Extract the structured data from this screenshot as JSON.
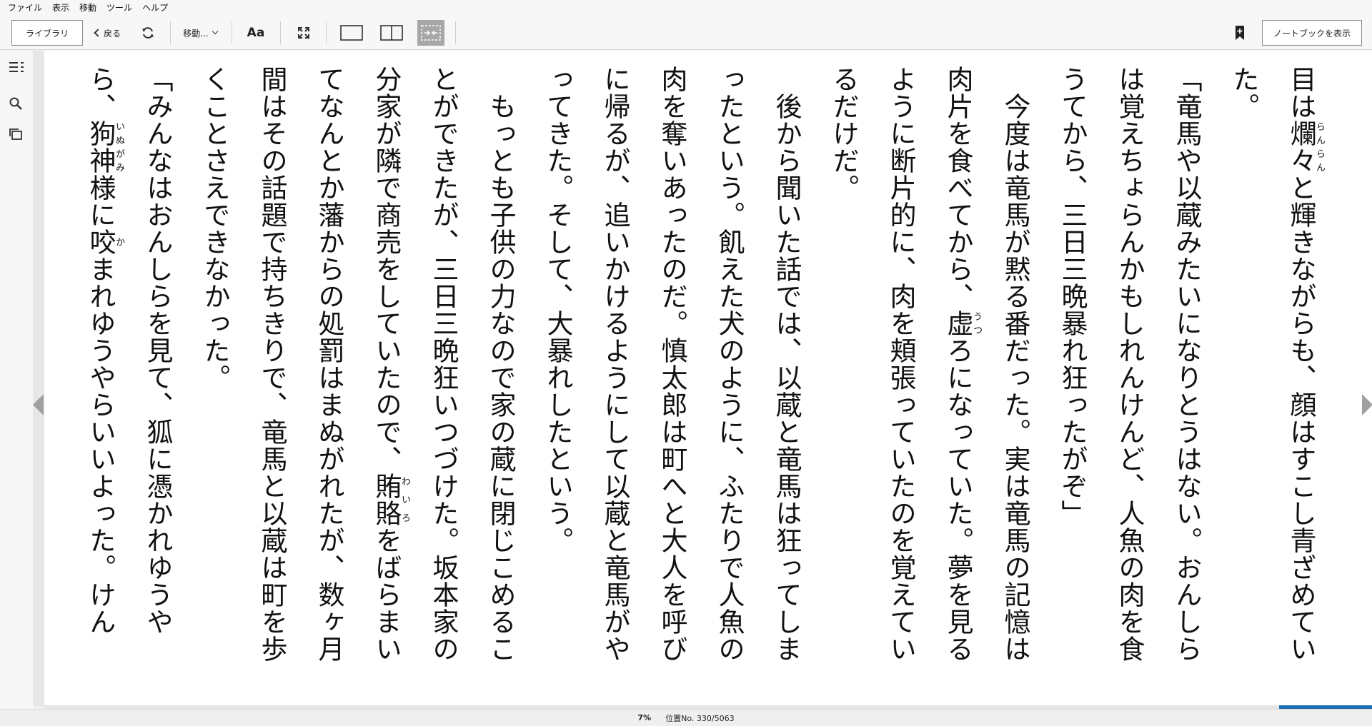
{
  "menubar": {
    "items": [
      "ファイル",
      "表示",
      "移動",
      "ツール",
      "ヘルプ"
    ]
  },
  "toolbar": {
    "library_label": "ライブラリ",
    "back_label": "戻る",
    "goto_label": "移動...",
    "font_label": "Aa",
    "notebook_label": "ノートブックを表示"
  },
  "colors": {
    "accent": "#1f6fb5",
    "toolbar_bg": "#f7f7f7",
    "page_bg": "#ffffff",
    "active_button_bg": "#a7a7a7"
  },
  "icons": {
    "sync": "sync-icon",
    "fullscreen": "fullscreen-icon",
    "single_page": "single-page-icon",
    "two_page": "two-page-icon",
    "fit_width": "fit-width-icon",
    "bookmark": "bookmark-icon",
    "toc": "toc-icon",
    "search": "search-icon",
    "flashcards": "flashcards-icon"
  },
  "book": {
    "paragraphs": [
      {
        "segments": [
          {
            "t": "目は"
          },
          {
            "t": "爛々",
            "ruby": "らんらん"
          },
          {
            "t": "と輝きながらも、顔はすこし青ざめていた。"
          }
        ]
      },
      {
        "segments": [
          {
            "t": "「竜馬や以蔵みたいになりとうはない。おんしらは覚えちょらんかもしれんけんど、人魚の肉を食うてから、三日三晩暴れ狂ったがぞ」"
          }
        ]
      },
      {
        "segments": [
          {
            "t": "　今度は竜馬が黙る番だった。実は竜馬の記憶は肉片を食べてから、"
          },
          {
            "t": "虚",
            "ruby": "うつ"
          },
          {
            "t": "ろになっていた。夢を見るように断片的に、肉を頬張っていたのを覚えているだけだ。"
          }
        ]
      },
      {
        "segments": [
          {
            "t": "　後から聞いた話では、以蔵と竜馬は狂ってしまったという。飢えた犬のように、ふたりで人魚の肉を奪いあったのだ。慎太郎は町へと大人を呼びに帰るが、追いかけるようにして以蔵と竜馬がやってきた。そして、大暴れしたという。"
          }
        ]
      },
      {
        "segments": [
          {
            "t": "　もっとも子供の力なので家の蔵に閉じこめることができたが、三日三晩狂いつづけた。坂本家の分家が隣で商売をしていたので、"
          },
          {
            "t": "賄賂",
            "ruby": "わいろ"
          },
          {
            "t": "をばらまいてなんとか藩からの処罰はまぬがれたが、数ヶ月間はその話題で持ちきりで、竜馬と以蔵は町を歩くことさえできなかった。"
          }
        ]
      },
      {
        "segments": [
          {
            "t": "「みんなはおんしらを見て、狐に憑かれゆうやら、"
          },
          {
            "t": "狗神",
            "ruby": "いぬがみ"
          },
          {
            "t": "様に"
          },
          {
            "t": "咬",
            "ruby": "か"
          },
          {
            "t": "まれゆうやらいいよった。けん"
          }
        ]
      }
    ]
  },
  "status": {
    "percent": "7%",
    "location": "位置No. 330/5063",
    "progress_fraction": 0.07
  }
}
